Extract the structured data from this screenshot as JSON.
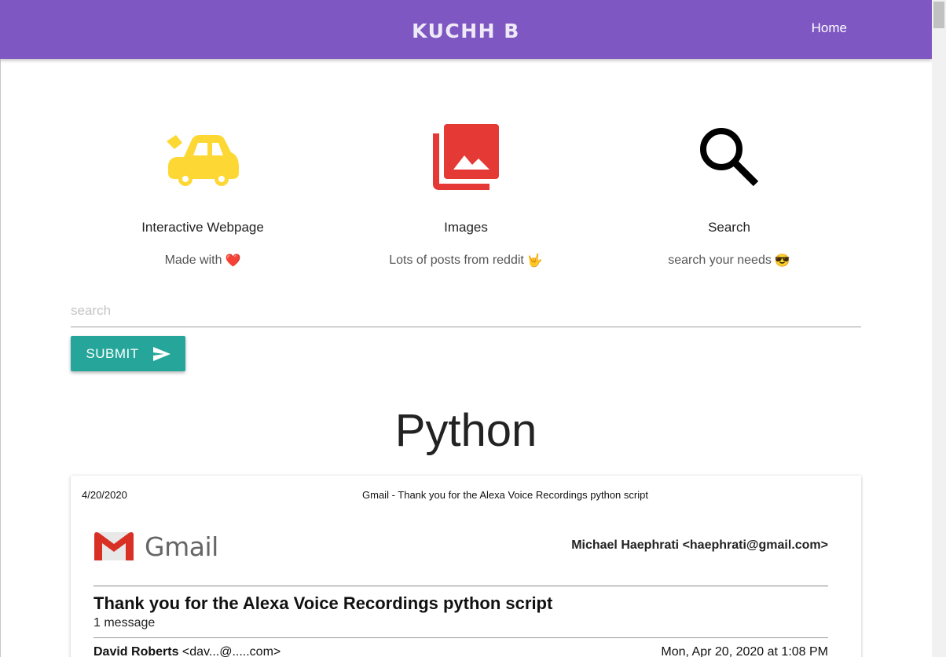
{
  "navbar": {
    "brand": "KUCHH B",
    "home_link": "Home",
    "bg_color": "#7e57c2"
  },
  "features": [
    {
      "icon": "car-icon",
      "color": "#fdd835",
      "title": "Interactive Webpage",
      "subtitle": "Made with",
      "emoji": "❤️"
    },
    {
      "icon": "photo-library-icon",
      "color": "#e53935",
      "title": "Images",
      "subtitle": "Lots of posts from reddit",
      "emoji": "🤟"
    },
    {
      "icon": "search-icon",
      "color": "#000000",
      "title": "Search",
      "subtitle": "search your needs",
      "emoji": "😎"
    }
  ],
  "search": {
    "placeholder": "search",
    "value": ""
  },
  "submit": {
    "label": "SUBMIT",
    "icon": "send-icon",
    "color": "#26a69a"
  },
  "section": {
    "title": "Python"
  },
  "post": {
    "date": "4/20/2020",
    "header": "Gmail - Thank you for the Alexa Voice Recordings python script",
    "logo_text": "Gmail",
    "from": "Michael Haephrati <haephrati@gmail.com>",
    "subject": "Thank you for the Alexa Voice Recordings python script",
    "message_count": "1 message",
    "sender_name": "David Roberts",
    "sender_addr": "<dav...@.....com>",
    "sent_date": "Mon, Apr 20, 2020 at 1:08 PM"
  }
}
